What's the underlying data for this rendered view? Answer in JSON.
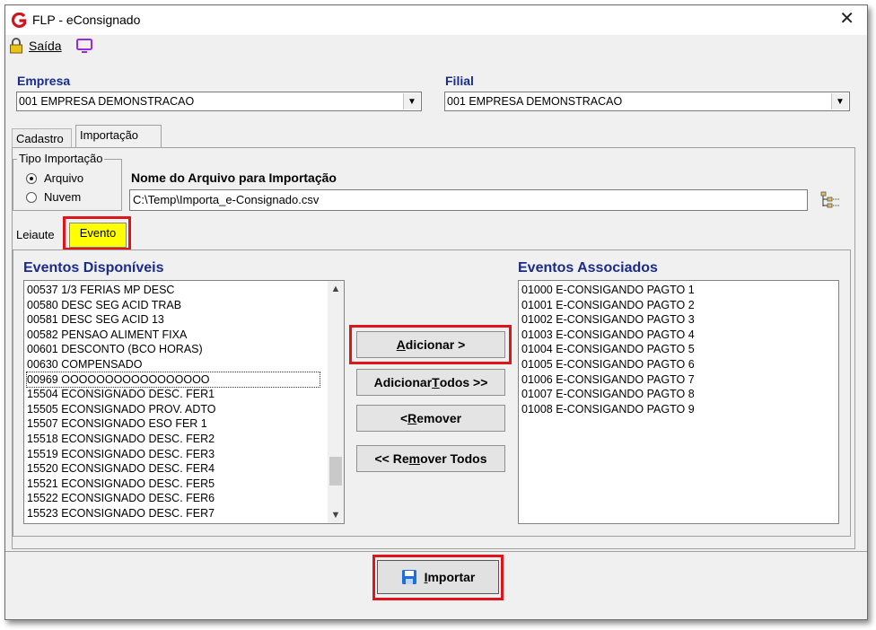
{
  "window": {
    "title": "FLP - eConsignado"
  },
  "menu": {
    "exit_label": "Saída",
    "icons": [
      "lock-icon",
      "monitor-icon"
    ]
  },
  "empresa": {
    "label": "Empresa",
    "value": "001 EMPRESA DEMONSTRACAO"
  },
  "filial": {
    "label": "Filial",
    "value": "001 EMPRESA DEMONSTRACAO"
  },
  "tabs": [
    {
      "label": "Cadastro"
    },
    {
      "label": "Importação",
      "active": true
    }
  ],
  "tipo_importacao": {
    "title": "Tipo Importação",
    "options": [
      {
        "label": "Arquivo",
        "selected": true
      },
      {
        "label": "Nuvem",
        "selected": false
      }
    ]
  },
  "arquivo": {
    "label": "Nome do Arquivo para Importação",
    "value": "C:\\Temp\\Importa_e-Consignado.csv"
  },
  "inner_tabs": [
    {
      "label": "Leiaute"
    },
    {
      "label": "Evento",
      "active": true
    }
  ],
  "disponiveis": {
    "title": "Eventos Disponíveis",
    "items": [
      "00537 1/3 FERIAS MP DESC",
      "00580 DESC SEG ACID TRAB",
      "00581 DESC SEG ACID 13",
      "00582 PENSAO ALIMENT FIXA",
      "00601 DESCONTO (BCO HORAS)",
      "00630 COMPENSADO",
      "00969 OOOOOOOOOOOOOOOOO",
      "15504 ECONSIGNADO DESC. FER1",
      "15505 ECONSIGNADO PROV. ADTO",
      "15507 ECONSIGNADO ESO FER 1",
      "15518 ECONSIGNADO DESC. FER2",
      "15519 ECONSIGNADO DESC. FER3",
      "15520 ECONSIGNADO DESC. FER4",
      "15521 ECONSIGNADO DESC. FER5",
      "15522 ECONSIGNADO DESC. FER6",
      "15523 ECONSIGNADO DESC. FER7"
    ],
    "focused_index": 6
  },
  "associados": {
    "title": "Eventos Associados",
    "items": [
      "01000 E-CONSIGANDO PAGTO 1",
      "01001 E-CONSIGANDO PAGTO 2",
      "01002 E-CONSIGANDO PAGTO 3",
      "01003 E-CONSIGANDO PAGTO 4",
      "01004 E-CONSIGANDO PAGTO 5",
      "01005 E-CONSIGANDO PAGTO 6",
      "01006 E-CONSIGANDO PAGTO 7",
      "01007 E-CONSIGANDO PAGTO 8",
      "01008 E-CONSIGANDO PAGTO 9"
    ]
  },
  "buttons": {
    "add_pre": "",
    "add_u": "A",
    "add_post": "dicionar >",
    "add_all_pre": "Adicionar ",
    "add_all_u": "T",
    "add_all_post": "odos >>",
    "remove_pre": "< ",
    "remove_u": "R",
    "remove_post": "emover",
    "remove_all_pre": "<< Re",
    "remove_all_u": "m",
    "remove_all_post": "over Todos",
    "import_pre": "",
    "import_u": "I",
    "import_post": "mportar"
  },
  "colors": {
    "highlight": "#e0141b",
    "active_tab": "#ffff00",
    "label_blue": "#1a2b8c"
  }
}
